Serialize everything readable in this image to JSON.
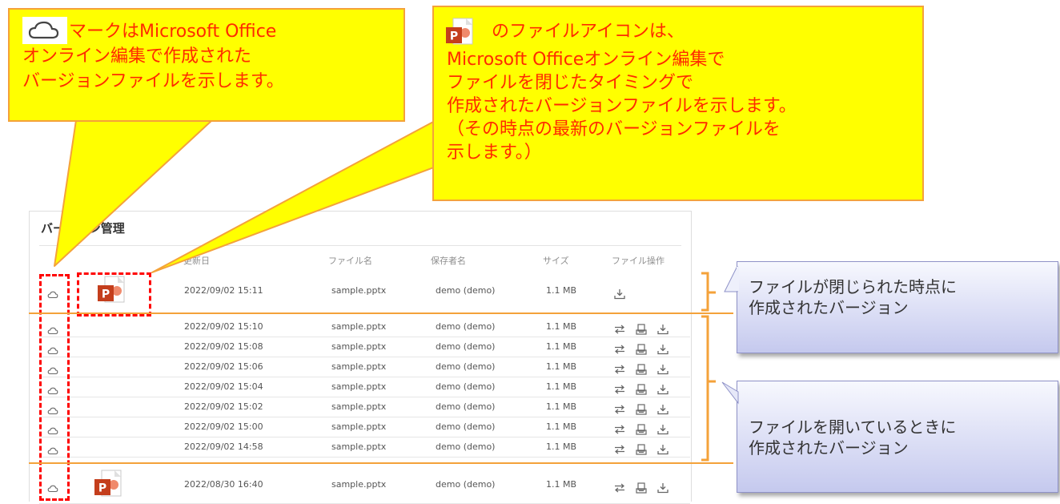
{
  "panel": {
    "title": "バージョン管理",
    "columns": {
      "date": "更新日",
      "file": "ファイル名",
      "saver": "保存者名",
      "size": "サイズ",
      "ops": "ファイル操作"
    }
  },
  "rows": [
    {
      "date": "2022/09/02 15:11",
      "file": "sample.pptx",
      "saver": "demo (demo)",
      "size": "1.1 MB",
      "ops": [
        "download"
      ],
      "ppt_icon": true
    },
    {
      "date": "2022/09/02 15:10",
      "file": "sample.pptx",
      "saver": "demo (demo)",
      "size": "1.1 MB",
      "ops": [
        "compare",
        "preview",
        "download"
      ]
    },
    {
      "date": "2022/09/02 15:08",
      "file": "sample.pptx",
      "saver": "demo (demo)",
      "size": "1.1 MB",
      "ops": [
        "compare",
        "preview",
        "download"
      ]
    },
    {
      "date": "2022/09/02 15:06",
      "file": "sample.pptx",
      "saver": "demo (demo)",
      "size": "1.1 MB",
      "ops": [
        "compare",
        "preview",
        "download"
      ]
    },
    {
      "date": "2022/09/02 15:04",
      "file": "sample.pptx",
      "saver": "demo (demo)",
      "size": "1.1 MB",
      "ops": [
        "compare",
        "preview",
        "download"
      ]
    },
    {
      "date": "2022/09/02 15:02",
      "file": "sample.pptx",
      "saver": "demo (demo)",
      "size": "1.1 MB",
      "ops": [
        "compare",
        "preview",
        "download"
      ]
    },
    {
      "date": "2022/09/02 15:00",
      "file": "sample.pptx",
      "saver": "demo (demo)",
      "size": "1.1 MB",
      "ops": [
        "compare",
        "preview",
        "download"
      ]
    },
    {
      "date": "2022/09/02 14:58",
      "file": "sample.pptx",
      "saver": "demo (demo)",
      "size": "1.1 MB",
      "ops": [
        "compare",
        "preview",
        "download"
      ]
    },
    {
      "date": "2022/08/30 16:40",
      "file": "sample.pptx",
      "saver": "demo (demo)",
      "size": "1.1 MB",
      "ops": [
        "compare",
        "preview",
        "download"
      ],
      "ppt_icon": true
    }
  ],
  "callouts": {
    "cloud_note": [
      "マークはMicrosoft Office",
      "オンライン編集で作成された",
      "バージョンファイルを示します。"
    ],
    "ppt_note": [
      "のファイルアイコンは、",
      "Microsoft Officeオンライン編集で",
      "ファイルを閉じたタイミングで",
      "作成されたバージョンファイルを示します。",
      "（その時点の最新のバージョンファイルを",
      "示します。）"
    ],
    "closed_note": [
      "ファイルが閉じられた時点に",
      "作成されたバージョン"
    ],
    "open_note": [
      "ファイルを開いているときに",
      "作成されたバージョン"
    ]
  },
  "icons": {
    "cloud": "cloud-icon",
    "ppt": "powerpoint-file-icon",
    "compare": "compare-arrows-icon",
    "preview": "preview-icon",
    "download": "download-icon"
  },
  "colors": {
    "callout_yellow": "#ffff00",
    "callout_text": "#ff2a00",
    "callout_border": "#f4a23a",
    "dash_red": "#ff0000",
    "bracket_orange": "#f4a23a",
    "blue_box_border": "#8f92c8"
  }
}
